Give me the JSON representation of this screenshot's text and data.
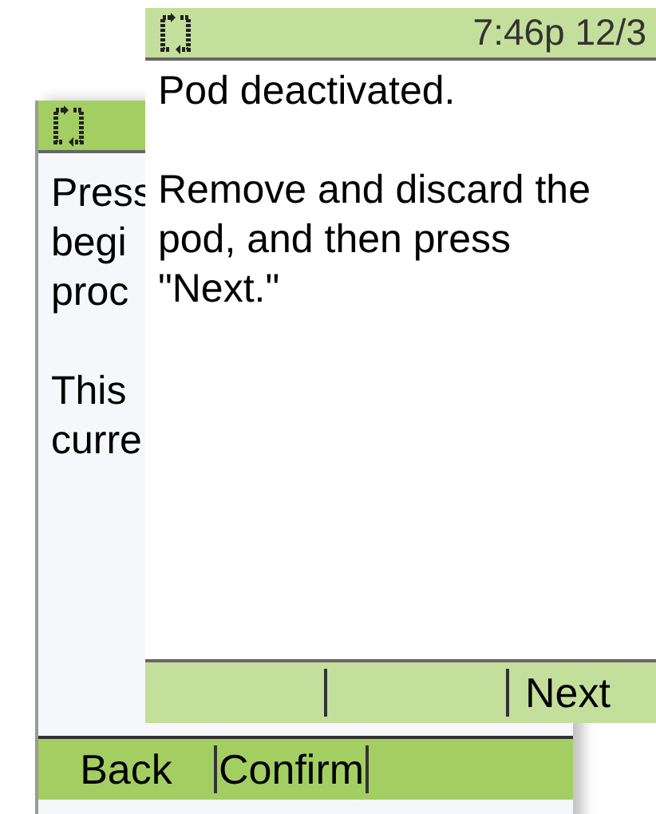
{
  "screens": [
    {
      "paragraphs": [
        {
          "lines": [
            "Press",
            "begi",
            "proc"
          ]
        },
        {
          "lines": [
            "This",
            "curre"
          ]
        }
      ],
      "softkeys": {
        "left": "Back",
        "middle": "Confirm"
      }
    },
    {
      "header": {
        "time": "7:46p 12/3"
      },
      "paragraphs": [
        {
          "lines": [
            "Pod deactivated."
          ]
        },
        {
          "lines": [
            "Remove and discard the",
            "pod, and then press",
            "\"Next.\""
          ]
        }
      ],
      "softkeys": {
        "right": "Next"
      }
    }
  ]
}
